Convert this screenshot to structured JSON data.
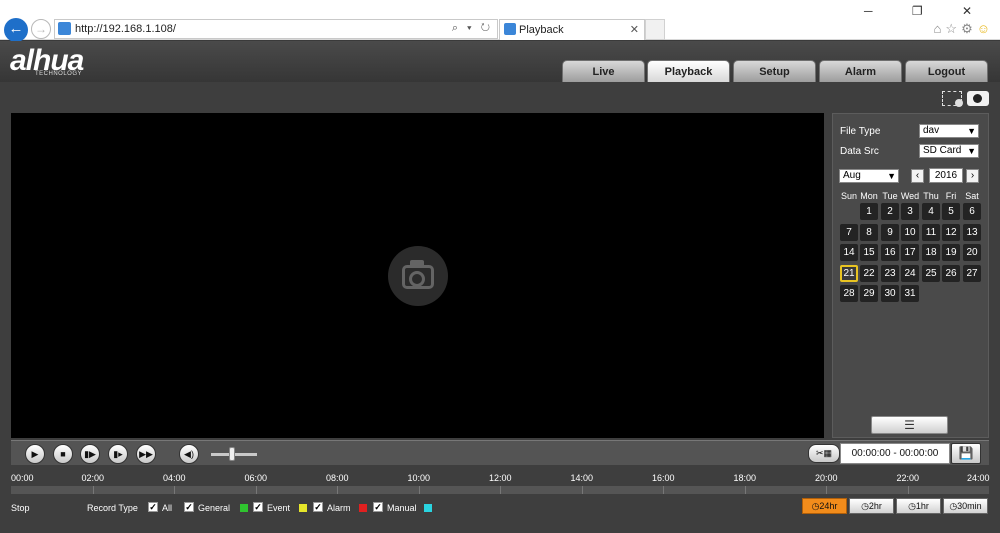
{
  "browser": {
    "url": "http://192.168.1.108/",
    "tab_title": "Playback",
    "addr_tools": "⌕ ▾ ↻",
    "tab_close": "✕",
    "window_controls": "─ ❐ ✕"
  },
  "app": {
    "logo": "alhua",
    "logo_sub": "TECHNOLOGY",
    "nav": [
      {
        "label": "Live"
      },
      {
        "label": "Playback"
      },
      {
        "label": "Setup"
      },
      {
        "label": "Alarm"
      },
      {
        "label": "Logout"
      }
    ],
    "active_tab": "Playback"
  },
  "panel": {
    "file_type_label": "File Type",
    "file_type_value": "dav",
    "data_src_label": "Data Src",
    "data_src_value": "SD Card",
    "month": "Aug",
    "year": "2016",
    "weekdays": [
      "Sun",
      "Mon",
      "Tue",
      "Wed",
      "Thu",
      "Fri",
      "Sat"
    ],
    "days": [
      "1",
      "2",
      "3",
      "4",
      "5",
      "6",
      "7",
      "8",
      "9",
      "10",
      "11",
      "12",
      "13",
      "14",
      "15",
      "16",
      "17",
      "18",
      "19",
      "20",
      "21",
      "22",
      "23",
      "24",
      "25",
      "26",
      "27",
      "28",
      "29",
      "30",
      "31"
    ],
    "selected_day": "21"
  },
  "controls": {
    "time_range": "00:00:00 - 00:00:00",
    "volume_level": 0.4
  },
  "timeline": {
    "labels": [
      "00:00",
      "02:00",
      "04:00",
      "06:00",
      "08:00",
      "10:00",
      "12:00",
      "14:00",
      "16:00",
      "18:00",
      "20:00",
      "22:00",
      "24:00"
    ]
  },
  "bottom": {
    "status": "Stop",
    "record_type_label": "Record Type",
    "record_types": [
      {
        "label": "All",
        "checked": true,
        "color": ""
      },
      {
        "label": "General",
        "checked": true,
        "color": "#2fc32f"
      },
      {
        "label": "Event",
        "checked": true,
        "color": "#e6e62a"
      },
      {
        "label": "Alarm",
        "checked": true,
        "color": "#e02020"
      },
      {
        "label": "Manual",
        "checked": true,
        "color": "#2ad4e0"
      }
    ],
    "ranges": [
      {
        "label": "24hr",
        "active": true
      },
      {
        "label": "2hr",
        "active": false
      },
      {
        "label": "1hr",
        "active": false
      },
      {
        "label": "30min",
        "active": false
      }
    ]
  }
}
